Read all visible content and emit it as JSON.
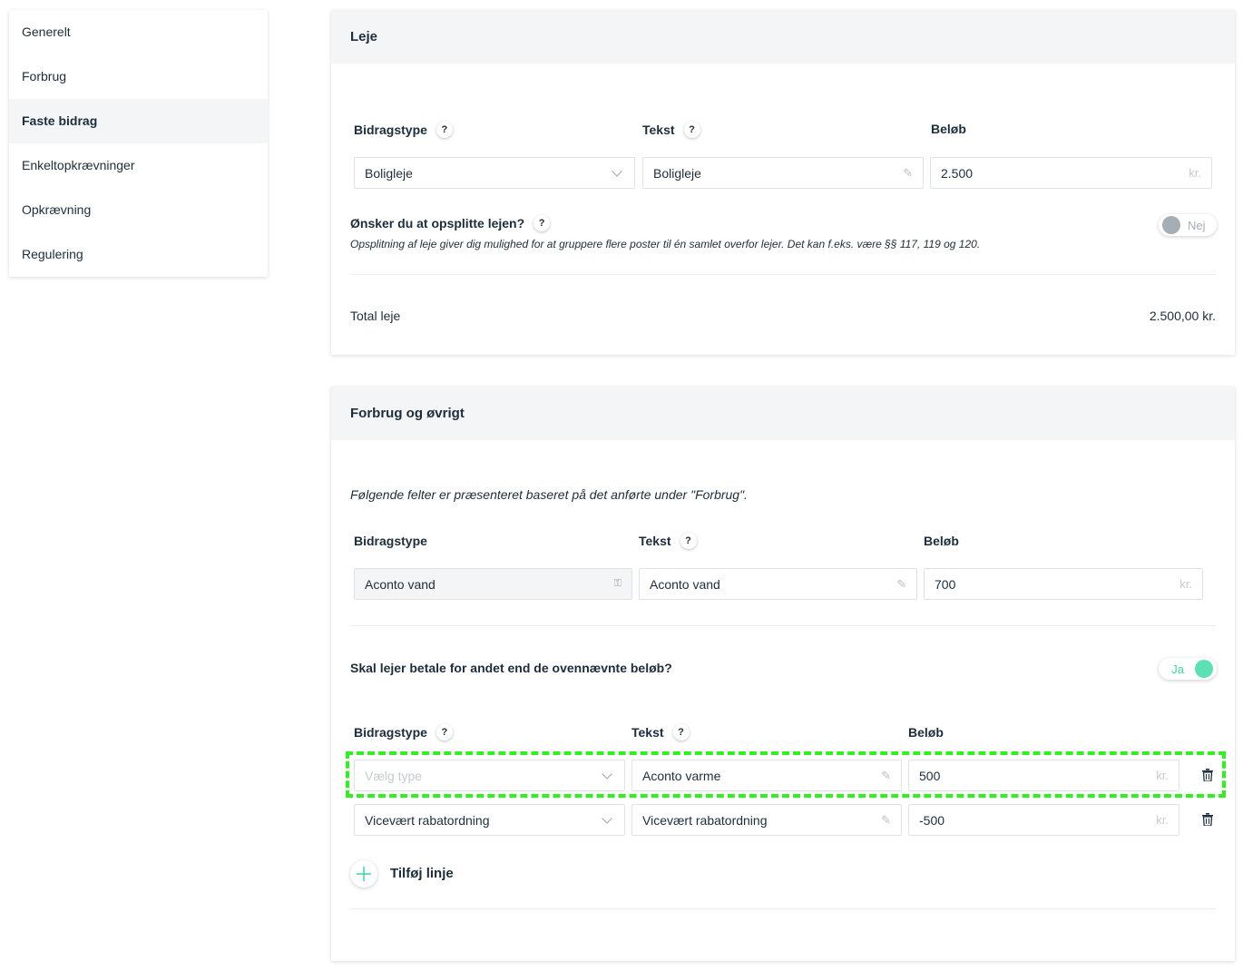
{
  "sidebar": {
    "items": [
      {
        "label": "Generelt"
      },
      {
        "label": "Forbrug"
      },
      {
        "label": "Faste bidrag"
      },
      {
        "label": "Enkeltopkrævninger"
      },
      {
        "label": "Opkrævning"
      },
      {
        "label": "Regulering"
      }
    ]
  },
  "rent": {
    "title": "Leje",
    "col_type": "Bidragstype",
    "col_text": "Tekst",
    "col_amount": "Beløb",
    "type_value": "Boligleje",
    "text_value": "Boligleje",
    "amount_value": "2.500",
    "unit": "kr.",
    "split_question": "Ønsker du at opsplitte lejen?",
    "split_note": "Opsplitning af leje giver dig mulighed for at gruppere flere poster til én samlet overfor lejer. Det kan f.eks. være §§ 117, 119 og 120.",
    "split_toggle": "Nej",
    "total_label": "Total leje",
    "total_value": "2.500,00 kr."
  },
  "consumption": {
    "title": "Forbrug og øvrigt",
    "note": "Følgende felter er præsenteret baseret på det anførte under \"Forbrug\".",
    "col_type": "Bidragstype",
    "col_text": "Tekst",
    "col_amount": "Beløb",
    "row": {
      "type": "Aconto vand",
      "text": "Aconto vand",
      "amount": "700",
      "unit": "kr."
    },
    "other_question": "Skal lejer betale for andet end de ovennævnte beløb?",
    "other_toggle": "Ja",
    "extra_col_type": "Bidragstype",
    "extra_col_text": "Tekst",
    "extra_col_amount": "Beløb",
    "extra_rows": [
      {
        "type_placeholder": "Vælg type",
        "text": "Aconto varme",
        "amount": "500",
        "unit": "kr."
      },
      {
        "type": "Vicevært rabatordning",
        "text": "Vicevært rabatordning",
        "amount": "-500",
        "unit": "kr."
      }
    ],
    "add_line": "Tilføj linje"
  },
  "help_glyph": "?",
  "colors": {
    "accent": "#3fd3a7",
    "highlight": "#33ee22",
    "text": "#1d2d3a"
  }
}
